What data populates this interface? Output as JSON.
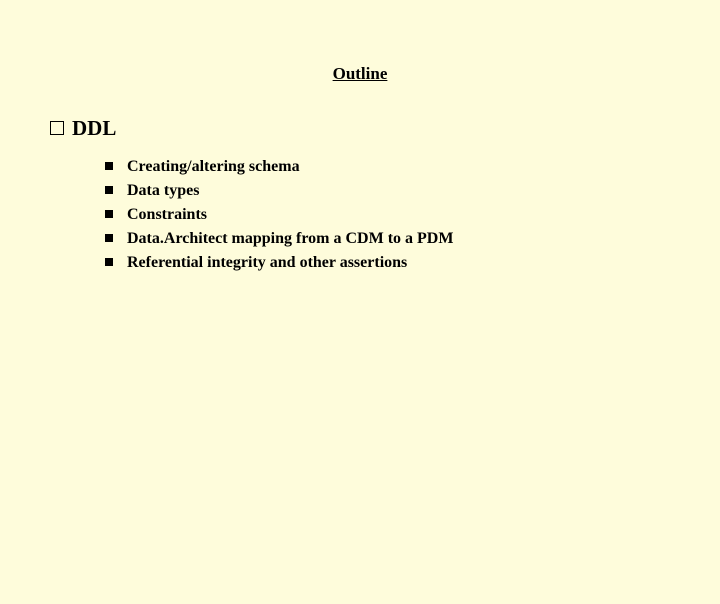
{
  "title": "Outline",
  "section": {
    "heading": "DDL",
    "items": [
      "Creating/altering schema",
      "Data types",
      "Constraints",
      "Data.Architect mapping from a CDM to a PDM",
      "Referential integrity and other assertions"
    ]
  }
}
